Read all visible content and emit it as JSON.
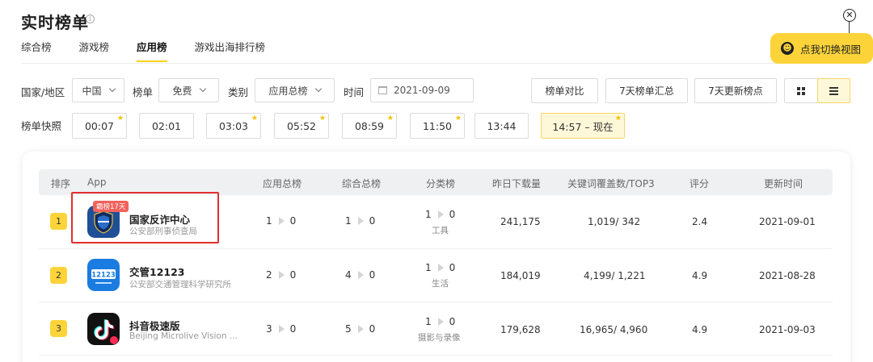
{
  "page": {
    "title": "实时榜单",
    "tabs": [
      "综合榜",
      "游戏榜",
      "应用榜",
      "游戏出海排行榜"
    ],
    "active_tab": "应用榜",
    "switch_view_label": "点我切换视图"
  },
  "filters": {
    "country_label": "国家/地区",
    "country_value": "中国",
    "chart_label": "榜单",
    "chart_value": "免费",
    "category_label": "类别",
    "category_value": "应用总榜",
    "time_label": "时间",
    "date_value": "2021-09-09",
    "buttons": [
      "榜单对比",
      "7天榜单汇总",
      "7天更新榜点"
    ]
  },
  "snapshots": {
    "label": "榜单快照",
    "items": [
      "00:07",
      "02:01",
      "03:03",
      "05:52",
      "08:59",
      "11:50",
      "13:44",
      "14:57 – 现在"
    ]
  },
  "table": {
    "headers": [
      "排序",
      "App",
      "应用总榜",
      "综合总榜",
      "分类榜",
      "昨日下载量",
      "关键词覆盖数/TOP3",
      "评分",
      "更新时间"
    ],
    "rows": [
      {
        "rank": "1",
        "badge": "霸榜17天",
        "name": "国家反诈中心",
        "developer": "公安部刑事侦查局",
        "app_rank_from": "1",
        "app_rank_to": "0",
        "overall_rank_from": "1",
        "overall_rank_to": "0",
        "category_rank_from": "1",
        "category_rank_to": "0",
        "category": "工具",
        "downloads": "241,175",
        "keywords": "1,019/ 342",
        "rating": "2.4",
        "updated": "2021-09-01"
      },
      {
        "rank": "2",
        "name": "交管12123",
        "developer": "公安部交通管理科学研究所",
        "app_rank_from": "2",
        "app_rank_to": "0",
        "overall_rank_from": "4",
        "overall_rank_to": "0",
        "category_rank_from": "1",
        "category_rank_to": "0",
        "category": "生活",
        "downloads": "184,019",
        "keywords": "4,199/ 1,221",
        "rating": "4.9",
        "updated": "2021-08-28"
      },
      {
        "rank": "3",
        "name": "抖音极速版",
        "developer": "Beijing Microlive Vision ...",
        "app_rank_from": "3",
        "app_rank_to": "0",
        "overall_rank_from": "5",
        "overall_rank_to": "0",
        "category_rank_from": "1",
        "category_rank_to": "0",
        "category": "摄影与录像",
        "downloads": "179,628",
        "keywords": "16,965/ 4,960",
        "rating": "4.9",
        "updated": "2021-09-03"
      }
    ]
  },
  "icons": {
    "info": "info-icon",
    "close": "close-icon",
    "smile": "smile-icon",
    "calendar": "calendar-icon",
    "grid_view": "grid-view-icon",
    "list_view": "list-view-icon",
    "icon_1": "12123"
  },
  "colors": {
    "accent": "#fcd43a",
    "highlight_border": "#e02f2f",
    "badge": "#f0625a"
  }
}
